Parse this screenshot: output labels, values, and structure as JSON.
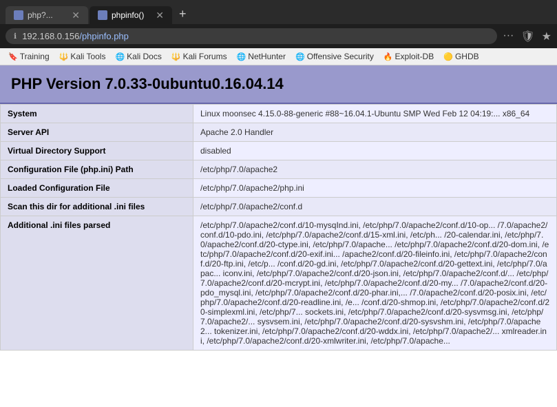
{
  "browser": {
    "tabs": [
      {
        "id": "tab1",
        "favicon": "php",
        "title": "php?...",
        "active": false,
        "closeable": true
      },
      {
        "id": "tab2",
        "favicon": "php",
        "title": "phpinfo()",
        "active": true,
        "closeable": true
      }
    ],
    "new_tab_label": "+",
    "address": {
      "protocol": "192.168.0.156",
      "path": "/phpinfo.php",
      "full": "192.168.0.156/phpinfo.php"
    },
    "toolbar_icons": [
      "···",
      "🛡",
      "★"
    ],
    "bookmarks": [
      {
        "icon": "🔖",
        "label": "Training"
      },
      {
        "icon": "🔱",
        "label": "Kali Tools"
      },
      {
        "icon": "🌐",
        "label": "Kali Docs"
      },
      {
        "icon": "🔱",
        "label": "Kali Forums"
      },
      {
        "icon": "🌐",
        "label": "NetHunter"
      },
      {
        "icon": "🌐",
        "label": "Offensive Security"
      },
      {
        "icon": "🔥",
        "label": "Exploit-DB"
      },
      {
        "icon": "🟡",
        "label": "GHDB"
      }
    ]
  },
  "page": {
    "php_version_label": "PHP Version 7.0.33-0ubuntu0.16.04.14",
    "table_rows": [
      {
        "key": "System",
        "value": "Linux moonsec 4.15.0-88-generic #88~16.04.1-Ubuntu SMP Wed Feb 12 04:19:... x86_64"
      },
      {
        "key": "Server API",
        "value": "Apache 2.0 Handler"
      },
      {
        "key": "Virtual Directory Support",
        "value": "disabled"
      },
      {
        "key": "Configuration File (php.ini) Path",
        "value": "/etc/php/7.0/apache2"
      },
      {
        "key": "Loaded Configuration File",
        "value": "/etc/php/7.0/apache2/php.ini"
      },
      {
        "key": "Scan this dir for additional .ini files",
        "value": "/etc/php/7.0/apache2/conf.d"
      },
      {
        "key": "Additional .ini files parsed",
        "value": "/etc/php/7.0/apache2/conf.d/10-mysqInd.ini, /etc/php/7.0/apache2/conf.d/10-op... /7.0/apache2/conf.d/10-pdo.ini, /etc/php/7.0/apache2/conf.d/15-xml.ini, /etc/ph... /20-calendar.ini, /etc/php/7.0/apache2/conf.d/20-ctype.ini, /etc/php/7.0/apache... /etc/php/7.0/apache2/conf.d/20-dom.ini, /etc/php/7.0/apache2/conf.d/20-exif.ini... /apache2/conf.d/20-fileinfo.ini, /etc/php/7.0/apache2/conf.d/20-ftp.ini, /etc/p... /conf.d/20-gd.ini, /etc/php/7.0/apache2/conf.d/20-gettext.ini, /etc/php/7.0/apac... iconv.ini, /etc/php/7.0/apache2/conf.d/20-json.ini, /etc/php/7.0/apache2/conf.d/... /etc/php/7.0/apache2/conf.d/20-mcrypt.ini, /etc/php/7.0/apache2/conf.d/20-my... /7.0/apache2/conf.d/20-pdo_mysql.ini, /etc/php/7.0/apache2/conf.d/20-phar.ini,... /7.0/apache2/conf.d/20-posix.ini, /etc/php/7.0/apache2/conf.d/20-readline.ini, /e... /conf.d/20-shmop.ini, /etc/php/7.0/apache2/conf.d/20-simplexml.ini, /etc/php/7... sockets.ini, /etc/php/7.0/apache2/conf.d/20-sysvmsg.ini, /etc/php/7.0/apache2/... sysvsem.ini, /etc/php/7.0/apache2/conf.d/20-sysvshm.ini, /etc/php/7.0/apache2... tokenizer.ini, /etc/php/7.0/apache2/conf.d/20-wddx.ini, /etc/php/7.0/apache2/... xmlreader.ini, /etc/php/7.0/apache2/conf.d/20-xmlwriter.ini, /etc/php/7.0/apache..."
      }
    ]
  }
}
